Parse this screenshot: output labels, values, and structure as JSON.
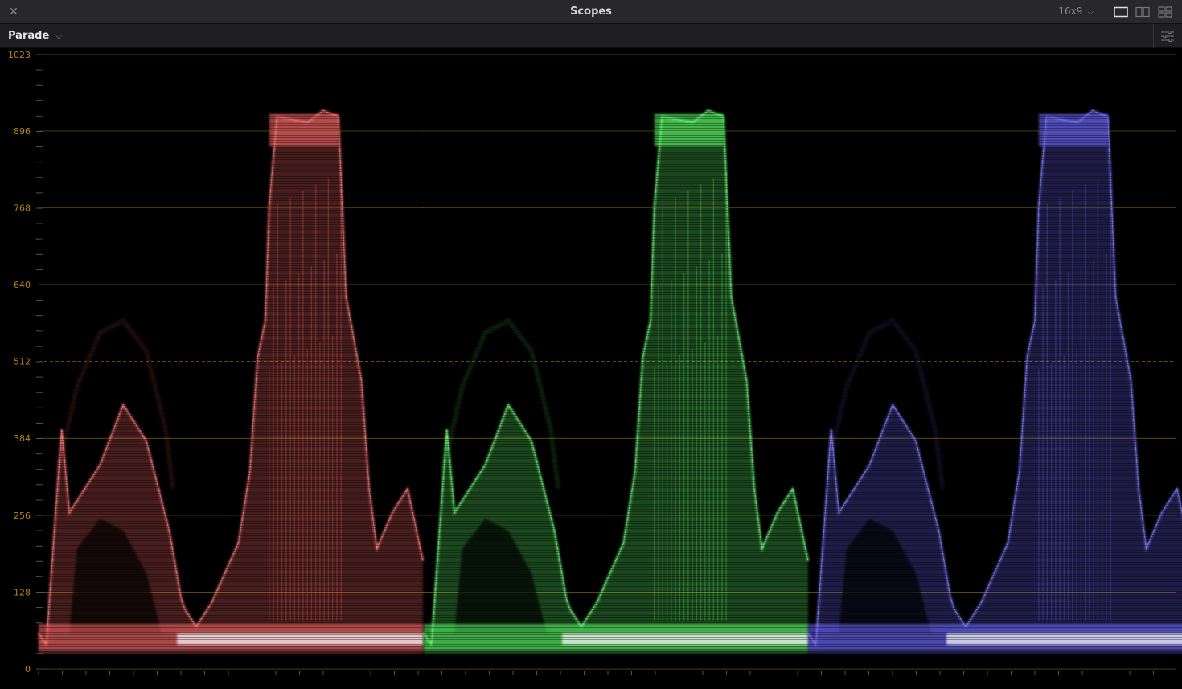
{
  "window": {
    "title": "Scopes",
    "aspect": "16x9",
    "close_icon": "close-icon",
    "layout_icons": [
      "single-view-icon",
      "dual-view-icon",
      "quad-view-icon"
    ]
  },
  "toolbar": {
    "scope_type": "Parade",
    "settings_icon": "sliders-icon"
  },
  "scope": {
    "y_axis": {
      "min": 0,
      "max": 1023,
      "tick_labels": [
        "1023",
        "896",
        "768",
        "640",
        "512",
        "384",
        "256",
        "128",
        "0"
      ],
      "midline": "512"
    },
    "channels": [
      {
        "name": "red",
        "color": "#ff6b6b"
      },
      {
        "name": "green",
        "color": "#5dff6a"
      },
      {
        "name": "blue",
        "color": "#6f6bff"
      }
    ],
    "graticule_color": "#b8860b"
  }
}
